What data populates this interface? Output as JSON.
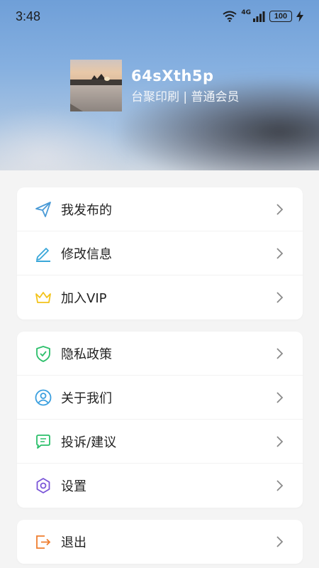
{
  "status_bar": {
    "time": "3:48",
    "network": "4G",
    "battery": "100"
  },
  "profile": {
    "username": "64sXth5p",
    "subtitle": "台聚印刷 | 普通会员"
  },
  "menu_groups": [
    {
      "items": [
        {
          "label": "我发布的",
          "icon": "send-icon"
        },
        {
          "label": "修改信息",
          "icon": "edit-icon"
        },
        {
          "label": "加入VIP",
          "icon": "crown-icon"
        }
      ]
    },
    {
      "items": [
        {
          "label": "隐私政策",
          "icon": "shield-check-icon"
        },
        {
          "label": "关于我们",
          "icon": "user-circle-icon"
        },
        {
          "label": "投诉/建议",
          "icon": "chat-bubble-icon"
        },
        {
          "label": "设置",
          "icon": "gear-icon"
        }
      ]
    },
    {
      "items": [
        {
          "label": "退出",
          "icon": "logout-icon"
        }
      ]
    }
  ],
  "colors": {
    "send": "#4a9ad6",
    "edit": "#3aa7d9",
    "crown": "#f3c31a",
    "shield": "#2bbf6a",
    "user": "#3a9fdf",
    "chat": "#2bbf6a",
    "gear": "#7a55d8",
    "logout": "#ef7d2e",
    "chevron": "#8a8a8a"
  }
}
